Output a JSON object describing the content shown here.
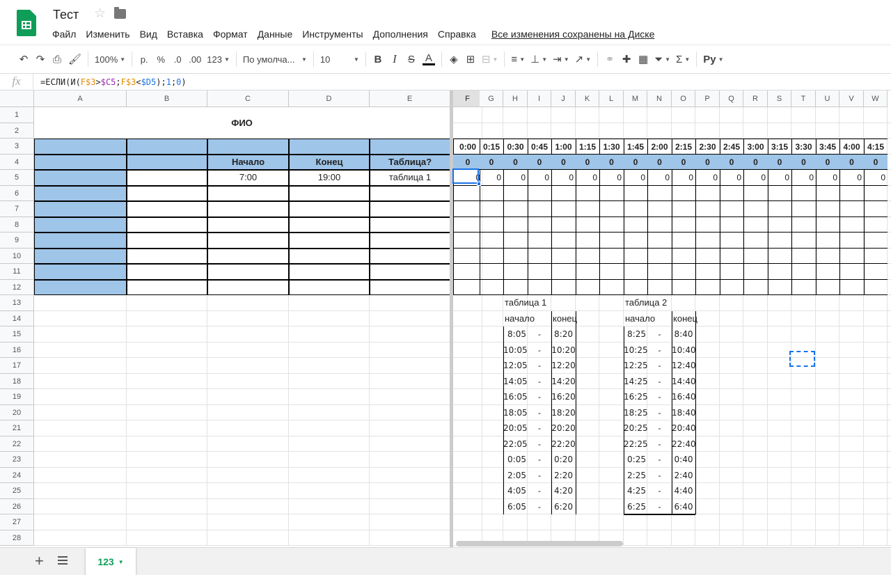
{
  "title": "Тест",
  "menu": [
    "Файл",
    "Изменить",
    "Вид",
    "Вставка",
    "Формат",
    "Данные",
    "Инструменты",
    "Дополнения",
    "Справка"
  ],
  "saved_status": "Все изменения сохранены на Диске",
  "toolbar": {
    "zoom": "100%",
    "currency": "р.",
    "percent": "%",
    "dec_less": ".0",
    "dec_more": ".00",
    "format": "123",
    "font": "По умолча...",
    "font_size": "10",
    "bold": "B",
    "italic": "I",
    "strike": "S",
    "text_color": "A",
    "sum": "Σ",
    "input_tools": "Ру"
  },
  "formula": {
    "fx": "fx",
    "text": "=ЕСЛИ(И(F$3>$C5;F$3<$D5);1;0)"
  },
  "columns": [
    "A",
    "B",
    "C",
    "D",
    "E",
    "F",
    "G",
    "H",
    "I",
    "J",
    "K",
    "L",
    "M",
    "N",
    "O",
    "P",
    "Q",
    "R",
    "S",
    "T",
    "U",
    "V",
    "W"
  ],
  "rows": [
    "1",
    "2",
    "3",
    "4",
    "5",
    "6",
    "7",
    "8",
    "9",
    "10",
    "11",
    "12",
    "13",
    "14",
    "15",
    "16",
    "17",
    "18",
    "19",
    "20",
    "21",
    "22",
    "23",
    "24",
    "25",
    "26",
    "27",
    "28"
  ],
  "sheet": {
    "fio": "ФИО",
    "headers": {
      "start": "Начало",
      "end": "Конец",
      "table": "Таблица?"
    },
    "row5": {
      "start": "7:00",
      "end": "19:00",
      "table": "таблица 1"
    },
    "times": [
      "0:00",
      "0:15",
      "0:30",
      "0:45",
      "1:00",
      "1:15",
      "1:30",
      "1:45",
      "2:00",
      "2:15",
      "2:30",
      "2:45",
      "3:00",
      "3:15",
      "3:30",
      "3:45",
      "4:00",
      "4:15"
    ],
    "row4_zero": "0",
    "row5_zero": "0",
    "table1": {
      "title": "таблица 1",
      "start_label": "начало",
      "end_label": "конец",
      "dash": "-",
      "start": [
        "8:05",
        "10:05",
        "12:05",
        "14:05",
        "16:05",
        "18:05",
        "20:05",
        "22:05",
        "0:05",
        "2:05",
        "4:05",
        "6:05"
      ],
      "end": [
        "8:20",
        "10:20",
        "12:20",
        "14:20",
        "16:20",
        "18:20",
        "20:20",
        "22:20",
        "0:20",
        "2:20",
        "4:20",
        "6:20"
      ]
    },
    "table2": {
      "title": "таблица 2",
      "start_label": "начало",
      "end_label": "конец",
      "dash": "-",
      "start": [
        "8:25",
        "10:25",
        "12:25",
        "14:25",
        "16:25",
        "18:25",
        "20:25",
        "22:25",
        "0:25",
        "2:25",
        "4:25",
        "6:25"
      ],
      "end": [
        "8:40",
        "10:40",
        "12:40",
        "14:40",
        "16:40",
        "18:40",
        "20:40",
        "22:40",
        "0:40",
        "2:40",
        "4:40",
        "6:40"
      ]
    }
  },
  "sheet_tab": "123",
  "colors": {
    "header_fill": "#9fc5e8",
    "accent": "#0f9d58",
    "selection": "#1a73e8"
  }
}
